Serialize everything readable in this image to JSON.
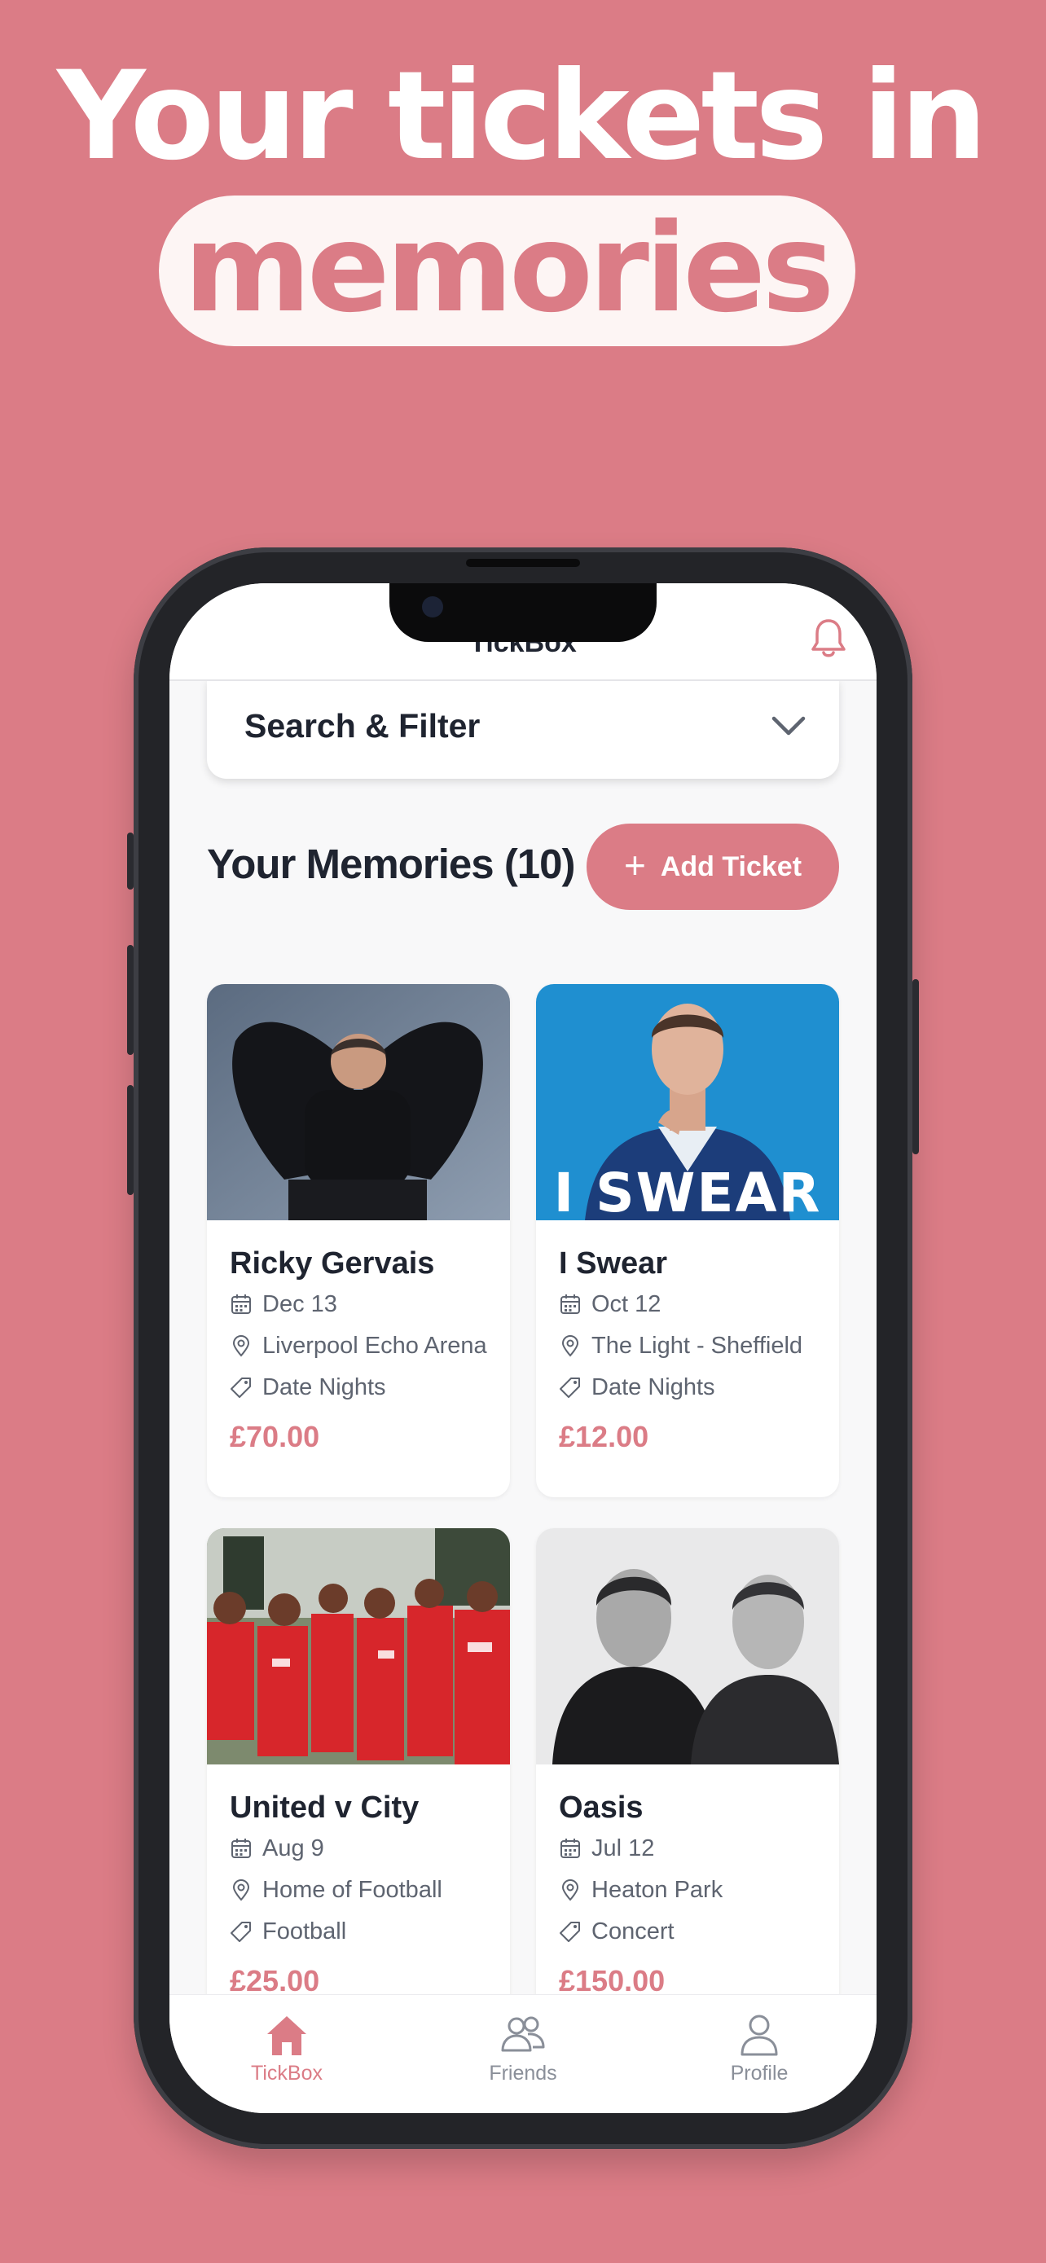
{
  "headline": {
    "line1": "Your tickets in",
    "highlight": "memories"
  },
  "app": {
    "title": "TickBox",
    "filter_label": "Search & Filter",
    "section_title": "Your Memories (10)",
    "add_button": "Add Ticket"
  },
  "cards": [
    {
      "title": "Ricky Gervais",
      "date": "Dec 13",
      "venue": "Liverpool Echo Arena",
      "tag": "Date Nights",
      "price": "£70.00"
    },
    {
      "title": "I Swear",
      "date": "Oct 12",
      "venue": "The Light - Sheffield",
      "tag": "Date Nights",
      "price": "£12.00",
      "poster_text": "I SWEAR"
    },
    {
      "title": "United v City",
      "date": "Aug 9",
      "venue": "Home of Football",
      "tag": "Football",
      "price": "£25.00"
    },
    {
      "title": "Oasis",
      "date": "Jul 12",
      "venue": "Heaton Park",
      "tag": "Concert",
      "price": "£150.00"
    }
  ],
  "tabs": [
    {
      "label": "TickBox",
      "icon": "home-icon",
      "active": true
    },
    {
      "label": "Friends",
      "icon": "friends-icon",
      "active": false
    },
    {
      "label": "Profile",
      "icon": "profile-icon",
      "active": false
    }
  ],
  "colors": {
    "brand": "#db7c86",
    "background": "#db7c86",
    "text": "#1f2430",
    "muted": "#5e6470",
    "tab_inactive": "#8a8f99"
  }
}
